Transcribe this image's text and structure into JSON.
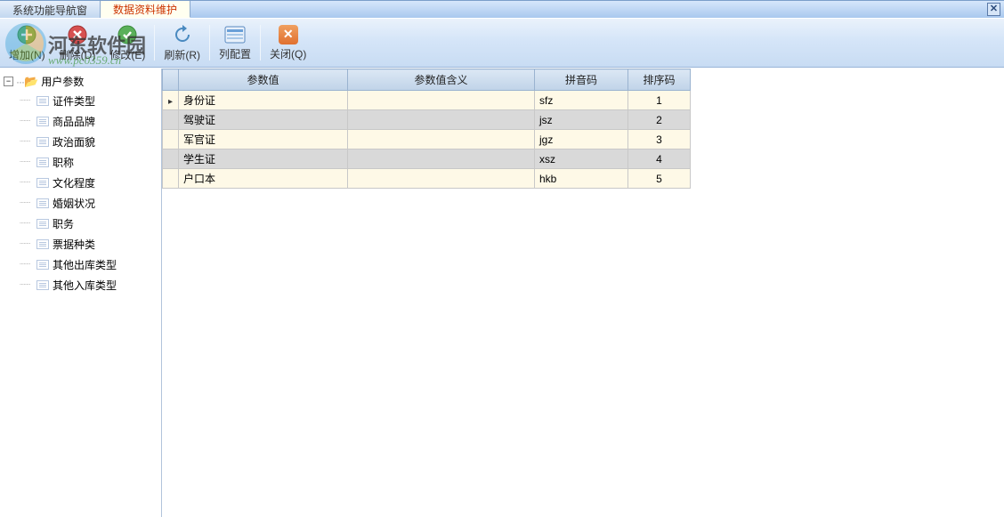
{
  "tabs": [
    {
      "label": "系统功能导航窗",
      "active": false
    },
    {
      "label": "数据资料维护",
      "active": true
    }
  ],
  "toolbar": {
    "add": "增加(N)",
    "delete": "删除(D)",
    "edit": "修改(E)",
    "refresh": "刷新(R)",
    "columns": "列配置",
    "close": "关闭(Q)"
  },
  "tree": {
    "root": "用户参数",
    "items": [
      "证件类型",
      "商品品牌",
      "政治面貌",
      "职称",
      "文化程度",
      "婚姻状况",
      "职务",
      "票据种类",
      "其他出库类型",
      "其他入库类型"
    ]
  },
  "grid": {
    "headers": {
      "param": "参数值",
      "meaning": "参数值含义",
      "pinyin": "拼音码",
      "sort": "排序码"
    },
    "rows": [
      {
        "param": "身份证",
        "meaning": "",
        "pinyin": "sfz",
        "sort": "1",
        "selected": true
      },
      {
        "param": "驾驶证",
        "meaning": "",
        "pinyin": "jsz",
        "sort": "2",
        "selected": false
      },
      {
        "param": "军官证",
        "meaning": "",
        "pinyin": "jgz",
        "sort": "3",
        "selected": false
      },
      {
        "param": "学生证",
        "meaning": "",
        "pinyin": "xsz",
        "sort": "4",
        "selected": false
      },
      {
        "param": "户口本",
        "meaning": "",
        "pinyin": "hkb",
        "sort": "5",
        "selected": false
      }
    ]
  },
  "watermark": {
    "title": "河东软件园",
    "url": "www.pc0359.cn"
  }
}
